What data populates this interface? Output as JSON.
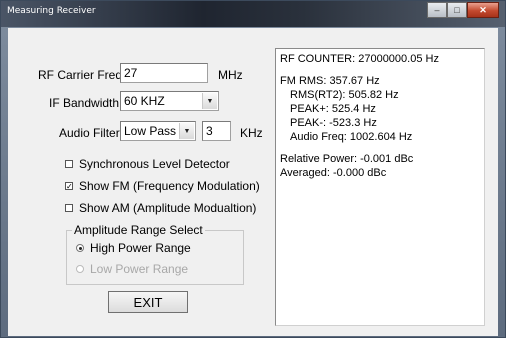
{
  "window": {
    "title": "Measuring Receiver",
    "controls": {
      "minimize": "‒",
      "maximize": "□",
      "close": "✕"
    }
  },
  "form": {
    "rf_carrier": {
      "label": "RF Carrier Freq",
      "value": "27",
      "unit": "MHz"
    },
    "if_bandwidth": {
      "label": "IF Bandwidth",
      "value": "60 KHZ"
    },
    "audio_filter": {
      "label": "Audio Filter",
      "type": "Low Pass",
      "value": "3",
      "unit": "KHz"
    },
    "checkboxes": [
      {
        "label": "Synchronous Level Detector",
        "checked": false
      },
      {
        "label": "Show FM (Frequency Modulation)",
        "checked": true
      },
      {
        "label": "Show AM (Amplitude Modualtion)",
        "checked": false
      }
    ],
    "amplitude_group": {
      "title": "Amplitude Range Select",
      "options": [
        {
          "label": "High Power Range",
          "selected": true,
          "enabled": true
        },
        {
          "label": "Low Power Range",
          "selected": false,
          "enabled": false
        }
      ]
    },
    "exit_label": "EXIT"
  },
  "readout": {
    "rf_counter": "RF COUNTER: 27000000.05 Hz",
    "fm_rms": "FM RMS: 357.67 Hz",
    "rms_rt2": "RMS(RT2): 505.82 Hz",
    "peak_plus": "PEAK+: 525.4 Hz",
    "peak_minus": "PEAK-: -523.3 Hz",
    "audio_freq": "Audio Freq: 1002.604 Hz",
    "relative_power": "Relative Power: -0.001 dBc",
    "averaged": "Averaged: -0.000 dBc"
  }
}
